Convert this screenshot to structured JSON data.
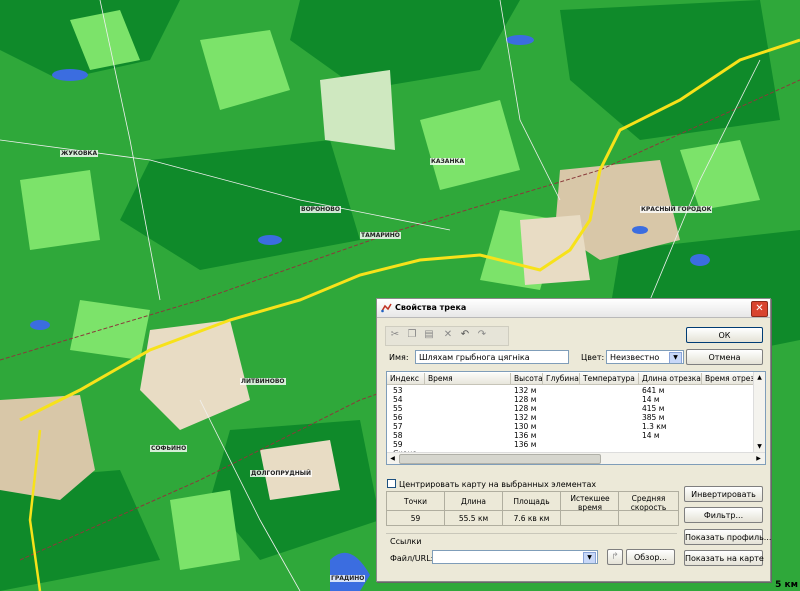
{
  "map": {
    "scale_text": "5 км",
    "colors": {
      "forest": "#2fa83a",
      "dark_forest": "#0f8a2a",
      "field": "#7ce36a",
      "urban": "#d8c7a8",
      "water": "#3b6de0",
      "road": "#f7e21a"
    },
    "places": [
      "ВОРОНОВО",
      "ТАМАРИНО",
      "КРАСНЫЙ ГОРОДОК",
      "СОФЬИНО",
      "ДОЛГОПРУДНЫЙ",
      "ЛИТВИНОВО",
      "КАЗАНКА",
      "ЖУКОВКА",
      "ГРАДИНО"
    ]
  },
  "dialog": {
    "title": "Свойства трека",
    "ok_label": "ОК",
    "cancel_label": "Отмена",
    "name_label": "Имя:",
    "name_value": "Шляхам грыбнога цягніка",
    "color_label": "Цвет:",
    "color_value": "Неизвестно",
    "table": {
      "headers": [
        "Индекс",
        "Время",
        "Высота",
        "Глубина",
        "Температура",
        "Длина отрезка",
        "Время отрезка"
      ],
      "rows": [
        [
          "53",
          "",
          "132 м",
          "",
          "",
          "641 м",
          ""
        ],
        [
          "54",
          "",
          "128 м",
          "",
          "",
          "14 м",
          ""
        ],
        [
          "55",
          "",
          "128 м",
          "",
          "",
          "415 м",
          ""
        ],
        [
          "56",
          "",
          "132 м",
          "",
          "",
          "385 м",
          ""
        ],
        [
          "57",
          "",
          "130 м",
          "",
          "",
          "1.3 км",
          ""
        ],
        [
          "58",
          "",
          "136 м",
          "",
          "",
          "14 м",
          ""
        ],
        [
          "59",
          "",
          "136 м",
          "",
          "",
          "",
          ""
        ]
      ],
      "more_label": "Сконе..."
    },
    "center_checkbox_label": "Центрировать карту на выбранных элементах",
    "invert_label": "Инвертировать",
    "filter_label": "Фильтр...",
    "stats": {
      "headers": [
        "Точки",
        "Длина",
        "Площадь",
        "Истекшее время",
        "Средняя скорость"
      ],
      "values": [
        "59",
        "55.5 км",
        "7.6 кв км",
        "",
        ""
      ]
    },
    "links_label": "Ссылки",
    "file_url_label": "Файл/URL:",
    "file_url_value": "",
    "browse_label": "Обзор...",
    "show_profile_label": "Показать профиль...",
    "show_on_map_label": "Показать на карте"
  }
}
